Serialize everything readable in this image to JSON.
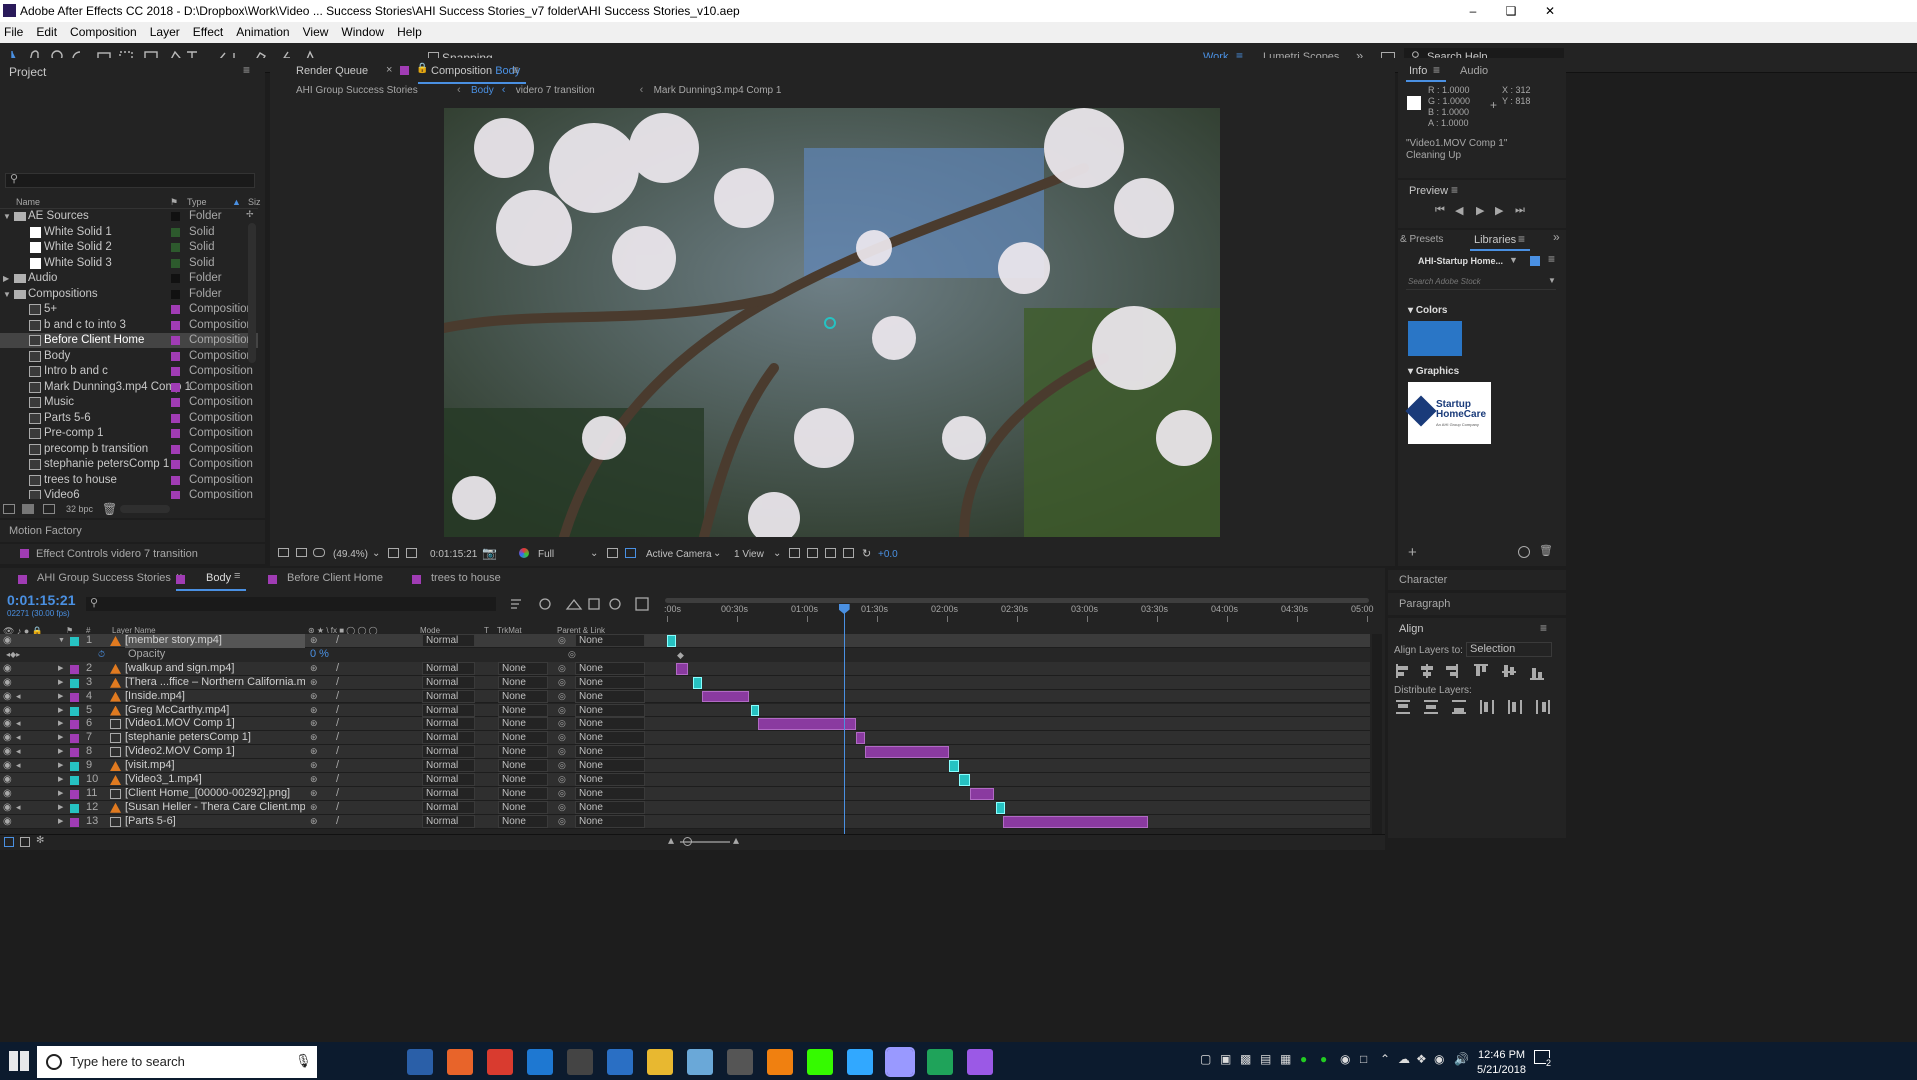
{
  "window": {
    "title": "Adobe After Effects CC 2018 - D:\\Dropbox\\Work\\Video ... Success Stories\\AHI Success Stories_v7 folder\\AHI Success Stories_v10.aep",
    "controls": [
      "minimize",
      "restore",
      "close"
    ]
  },
  "menu": [
    "File",
    "Edit",
    "Composition",
    "Layer",
    "Effect",
    "Animation",
    "View",
    "Window",
    "Help"
  ],
  "toolbar": {
    "snapping": "Snapping",
    "workspace": "Work",
    "lumetri": "Lumetri Scopes",
    "search_help": "Search Help"
  },
  "project": {
    "title": "Project",
    "col_name": "Name",
    "col_type": "Type",
    "col_size": "Siz",
    "bpc": "32 bpc",
    "items": [
      {
        "name": "AE Sources",
        "type": "Folder",
        "kind": "folder",
        "indent": 0,
        "swatch": "#111111",
        "expanded": true
      },
      {
        "name": "White Solid 1",
        "type": "Solid",
        "kind": "solid",
        "indent": 1,
        "swatch": "#2d5a2d"
      },
      {
        "name": "White Solid 2",
        "type": "Solid",
        "kind": "solid",
        "indent": 1,
        "swatch": "#2d5a2d"
      },
      {
        "name": "White Solid 3",
        "type": "Solid",
        "kind": "solid",
        "indent": 1,
        "swatch": "#2d5a2d"
      },
      {
        "name": "Audio",
        "type": "Folder",
        "kind": "folder",
        "indent": 0,
        "swatch": "#111111",
        "expanded": false
      },
      {
        "name": "Compositions",
        "type": "Folder",
        "kind": "folder",
        "indent": 0,
        "swatch": "#111111",
        "expanded": true
      },
      {
        "name": "5+",
        "type": "Composition",
        "kind": "comp",
        "indent": 1,
        "swatch": "#a03cb4"
      },
      {
        "name": "b and c to into 3",
        "type": "Composition",
        "kind": "comp",
        "indent": 1,
        "swatch": "#a03cb4"
      },
      {
        "name": "Before Client Home",
        "type": "Composition",
        "kind": "comp",
        "indent": 1,
        "swatch": "#a03cb4",
        "selected": true
      },
      {
        "name": "Body",
        "type": "Composition",
        "kind": "comp",
        "indent": 1,
        "swatch": "#a03cb4"
      },
      {
        "name": "Intro b and c",
        "type": "Composition",
        "kind": "comp",
        "indent": 1,
        "swatch": "#a03cb4"
      },
      {
        "name": "Mark Dunning3.mp4 Comp 1",
        "type": "Composition",
        "kind": "comp",
        "indent": 1,
        "swatch": "#a03cb4"
      },
      {
        "name": "Music",
        "type": "Composition",
        "kind": "comp",
        "indent": 1,
        "swatch": "#a03cb4"
      },
      {
        "name": "Parts 5-6",
        "type": "Composition",
        "kind": "comp",
        "indent": 1,
        "swatch": "#a03cb4"
      },
      {
        "name": "Pre-comp 1",
        "type": "Composition",
        "kind": "comp",
        "indent": 1,
        "swatch": "#a03cb4"
      },
      {
        "name": "precomp b transition",
        "type": "Composition",
        "kind": "comp",
        "indent": 1,
        "swatch": "#a03cb4"
      },
      {
        "name": "stephanie petersComp 1",
        "type": "Composition",
        "kind": "comp",
        "indent": 1,
        "swatch": "#a03cb4"
      },
      {
        "name": "trees to house",
        "type": "Composition",
        "kind": "comp",
        "indent": 1,
        "swatch": "#a03cb4"
      },
      {
        "name": "Video6",
        "type": "Composition",
        "kind": "comp",
        "indent": 1,
        "swatch": "#a03cb4"
      }
    ]
  },
  "motion_factory": "Motion Factory",
  "effect_controls": "Effect Controls videro 7 transition",
  "comp_panel": {
    "render_queue": "Render Queue",
    "comp_prefix": "Composition",
    "comp_name": "Body",
    "crumbs": [
      "AHI Group Success Stories",
      "Body",
      "videro 7 transition",
      "Mark Dunning3.mp4 Comp 1"
    ],
    "zoom": "(49.4%)",
    "timecode": "0:01:15:21",
    "resolution": "Full",
    "camera": "Active Camera",
    "views": "1 View",
    "exposure": "+0.0"
  },
  "info": {
    "tab_info": "Info",
    "tab_audio": "Audio",
    "r": "R : 1.0000",
    "g": "G : 1.0000",
    "b": "B : 1.0000",
    "a": "A : 1.0000",
    "x": "X : 312",
    "y": "Y : 818",
    "layer": "\"Video1.MOV Comp 1\"",
    "status": "Cleaning Up"
  },
  "preview": {
    "title": "Preview"
  },
  "libraries": {
    "tab_presets": "& Presets",
    "tab_libraries": "Libraries",
    "library": "AHI-Startup Home...",
    "search": "Search Adobe Stock",
    "colors": "Colors",
    "color_swatch": "#2a76c6",
    "graphics": "Graphics",
    "logo_text": "Startup HomeCare",
    "logo_sub": "An AHI Group Company"
  },
  "right_lower": {
    "character": "Character",
    "paragraph": "Paragraph",
    "align": "Align",
    "align_to_label": "Align Layers to:",
    "align_to": "Selection",
    "distribute": "Distribute Layers:"
  },
  "timeline": {
    "tabs": [
      {
        "name": "AHI Group Success Stories",
        "color": "#a03cb4"
      },
      {
        "name": "Body",
        "color": "#a03cb4",
        "active": true
      },
      {
        "name": "Before Client Home",
        "color": "#a03cb4"
      },
      {
        "name": "trees to house",
        "color": "#a03cb4"
      }
    ],
    "timecode": "0:01:15:21",
    "frames": "02271 (30.00 fps)",
    "headers": {
      "layer_name": "Layer Name",
      "mode": "Mode",
      "t": "T",
      "trkmat": "TrkMat",
      "parent": "Parent & Link"
    },
    "ruler": [
      ":00s",
      "00:30s",
      "01:00s",
      "01:30s",
      "02:00s",
      "02:30s",
      "03:00s",
      "03:30s",
      "04:00s",
      "04:30s",
      "05:00"
    ],
    "ruler_max_s": 300,
    "playhead_s": 75.7,
    "opacity_label": "Opacity",
    "opacity_value": "0 %",
    "layers": [
      {
        "num": "1",
        "name": "[member story.mp4]",
        "icon": "footage",
        "label": "#26c2c2",
        "mode": "Normal",
        "trkmat": "",
        "parent": "None",
        "audio": false,
        "start": 0,
        "end": 4,
        "kf": true
      },
      {
        "num": "2",
        "name": "[walkup and sign.mp4]",
        "icon": "footage",
        "label": "#a03cb4",
        "mode": "Normal",
        "trkmat": "None",
        "parent": "None",
        "audio": false,
        "start": 4,
        "end": 9
      },
      {
        "num": "3",
        "name": "[Thera ...ffice – Northern California.mp4]",
        "icon": "footage",
        "label": "#26c2c2",
        "mode": "Normal",
        "trkmat": "None",
        "parent": "None",
        "audio": false,
        "start": 11,
        "end": 15,
        "kf": true
      },
      {
        "num": "4",
        "name": "[Inside.mp4]",
        "icon": "footage",
        "label": "#a03cb4",
        "mode": "Normal",
        "trkmat": "None",
        "parent": "None",
        "audio": true,
        "start": 15,
        "end": 35
      },
      {
        "num": "5",
        "name": "[Greg McCarthy.mp4]",
        "icon": "footage",
        "label": "#26c2c2",
        "mode": "Normal",
        "trkmat": "None",
        "parent": "None",
        "audio": false,
        "start": 36,
        "end": 39,
        "kf": true
      },
      {
        "num": "6",
        "name": "[Video1.MOV Comp 1]",
        "icon": "comp",
        "label": "#a03cb4",
        "mode": "Normal",
        "trkmat": "None",
        "parent": "None",
        "audio": true,
        "start": 39,
        "end": 81
      },
      {
        "num": "7",
        "name": "[stephanie petersComp 1]",
        "icon": "comp",
        "label": "#a03cb4",
        "mode": "Normal",
        "trkmat": "None",
        "parent": "None",
        "audio": true,
        "start": 81,
        "end": 85
      },
      {
        "num": "8",
        "name": "[Video2.MOV Comp 1]",
        "icon": "comp",
        "label": "#a03cb4",
        "mode": "Normal",
        "trkmat": "None",
        "parent": "None",
        "audio": true,
        "start": 85,
        "end": 121
      },
      {
        "num": "9",
        "name": "[visit.mp4]",
        "icon": "footage",
        "label": "#26c2c2",
        "mode": "Normal",
        "trkmat": "None",
        "parent": "None",
        "audio": true,
        "start": 121,
        "end": 125,
        "kf": true
      },
      {
        "num": "10",
        "name": "[Video3_1.mp4]",
        "icon": "footage",
        "label": "#26c2c2",
        "mode": "Normal",
        "trkmat": "None",
        "parent": "None",
        "audio": false,
        "start": 125,
        "end": 130,
        "kf": true
      },
      {
        "num": "11",
        "name": "[Client Home_[00000-00292].png]",
        "icon": "comp",
        "label": "#a03cb4",
        "mode": "Normal",
        "trkmat": "None",
        "parent": "None",
        "audio": false,
        "start": 130,
        "end": 140
      },
      {
        "num": "12",
        "name": "[Susan Heller - Thera Care Client.mp4]",
        "icon": "footage",
        "label": "#26c2c2",
        "mode": "Normal",
        "trkmat": "None",
        "parent": "None",
        "audio": true,
        "start": 141,
        "end": 145,
        "kf": true
      },
      {
        "num": "13",
        "name": "[Parts 5-6]",
        "icon": "comp",
        "label": "#a03cb4",
        "mode": "Normal",
        "trkmat": "None",
        "parent": "None",
        "audio": false,
        "start": 144,
        "end": 206
      }
    ]
  },
  "taskbar": {
    "search": "Type here to search",
    "time": "12:46 PM",
    "date": "5/21/2018",
    "notif": "2",
    "apps": [
      {
        "icon": "task-view-icon",
        "color": "#0c1b2e"
      },
      {
        "icon": "outlook-bird-icon",
        "color": "#2a5fa8"
      },
      {
        "icon": "firefox-icon",
        "color": "#e8642a"
      },
      {
        "icon": "chrome-icon",
        "color": "#d93b2f"
      },
      {
        "icon": "edge-icon",
        "color": "#1e78d2"
      },
      {
        "icon": "store-icon",
        "color": "#444444"
      },
      {
        "icon": "pc-icon",
        "color": "#2a6fc4"
      },
      {
        "icon": "explorer-icon",
        "color": "#e8b830"
      },
      {
        "icon": "app-icon",
        "color": "#6aa8d8"
      },
      {
        "icon": "clapper-icon",
        "color": "#555555"
      },
      {
        "icon": "vlc-icon",
        "color": "#f08010"
      },
      {
        "icon": "dreamweaver-icon",
        "color": "#35fa00"
      },
      {
        "icon": "photoshop-icon",
        "color": "#31a8ff"
      },
      {
        "icon": "after-effects-icon",
        "color": "#9999ff"
      },
      {
        "icon": "green-app-icon",
        "color": "#1fa35a"
      },
      {
        "icon": "premiere-like-icon",
        "color": "#9b59e6"
      }
    ]
  }
}
